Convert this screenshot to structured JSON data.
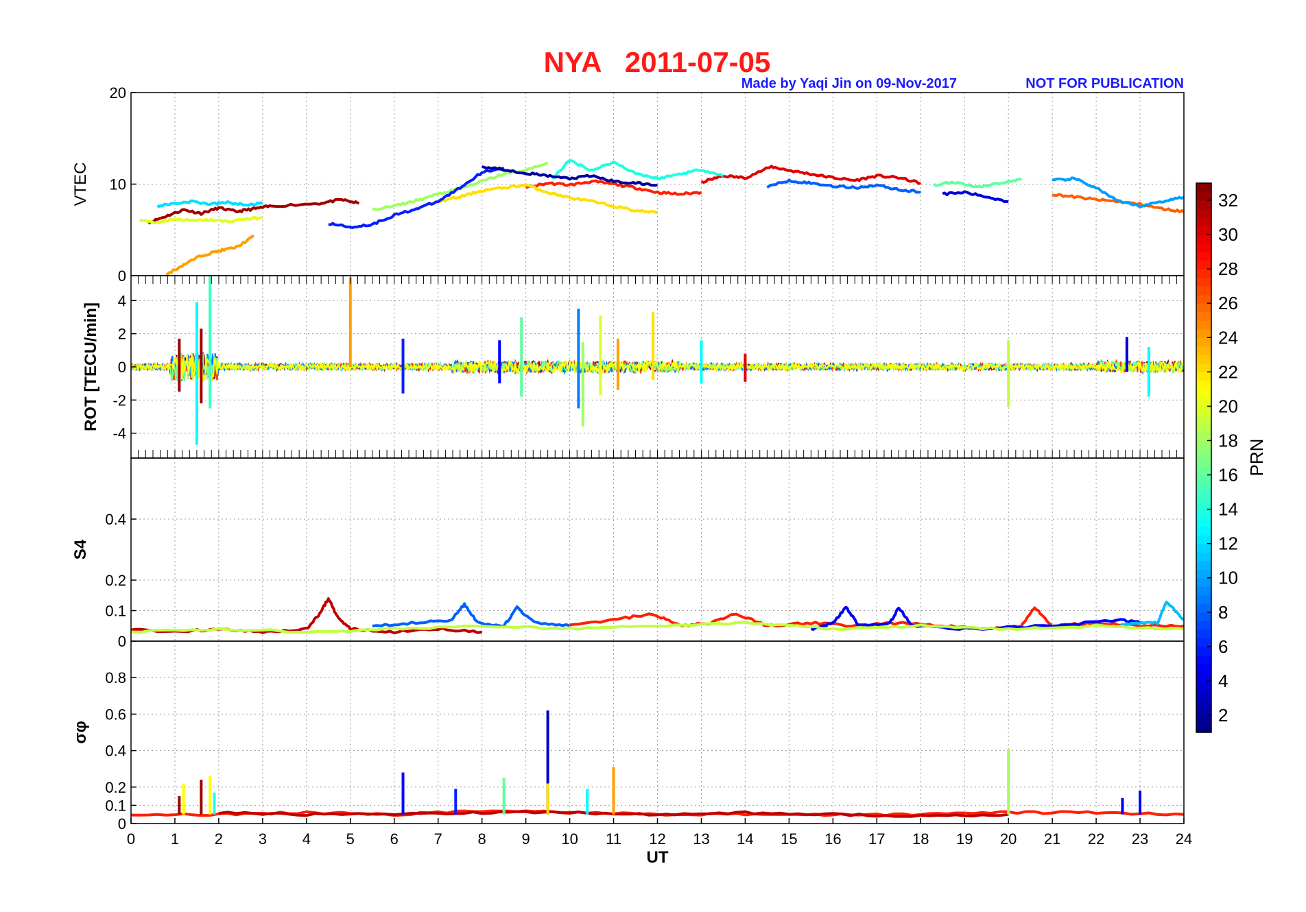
{
  "header": {
    "title": "NYA   2011-07-05",
    "credit": "Made by Yaqi Jin on 09-Nov-2017",
    "notice": "NOT FOR PUBLICATION"
  },
  "chart_data": [
    {
      "type": "line",
      "panel": "vtec",
      "ylabel": "VTEC",
      "xlim": [
        0,
        24
      ],
      "ylim": [
        0,
        20
      ],
      "yticks": [
        0,
        10,
        20
      ],
      "grid": true,
      "series": [
        {
          "prn": 32,
          "x": [
            0.4,
            0.8,
            1.2,
            1.6,
            2.0,
            2.4,
            2.8,
            3.2,
            4.3,
            4.8,
            5.2
          ],
          "y": [
            5.8,
            6.5,
            7.2,
            6.8,
            7.4,
            7.0,
            7.3,
            7.6,
            7.9,
            8.3,
            7.9
          ]
        },
        {
          "prn": 30,
          "x": [
            13.0,
            13.5,
            14.0,
            14.6,
            15.0,
            15.5,
            16.0,
            16.5,
            17.0,
            17.5,
            18.0
          ],
          "y": [
            10.2,
            10.9,
            10.7,
            11.9,
            11.5,
            11.1,
            10.7,
            10.4,
            10.9,
            10.7,
            10.1
          ]
        },
        {
          "prn": 28,
          "x": [
            9.0,
            9.5,
            10.0,
            10.5,
            11.0,
            11.5,
            12.0,
            12.5,
            13.0
          ],
          "y": [
            9.6,
            10.1,
            9.9,
            10.3,
            10.0,
            9.6,
            9.1,
            8.9,
            9.1
          ]
        },
        {
          "prn": 26,
          "x": [
            21.0,
            21.5,
            22.0,
            22.5,
            23.0,
            23.5,
            24.0
          ],
          "y": [
            8.9,
            8.6,
            8.3,
            8.1,
            7.8,
            7.3,
            7.0
          ]
        },
        {
          "prn": 24,
          "x": [
            0.8,
            1.2,
            1.6,
            2.0,
            2.4,
            2.8
          ],
          "y": [
            0.1,
            1.2,
            2.2,
            2.7,
            3.1,
            4.3
          ]
        },
        {
          "prn": 22,
          "x": [
            7.0,
            7.5,
            8.0,
            8.5,
            9.0,
            9.5,
            10.0,
            10.5,
            11.0,
            11.5,
            12.0
          ],
          "y": [
            8.1,
            8.6,
            9.3,
            9.6,
            9.9,
            9.1,
            8.5,
            8.1,
            7.6,
            7.1,
            6.9
          ]
        },
        {
          "prn": 20,
          "x": [
            0.2,
            0.6,
            1.0,
            1.4,
            1.8,
            2.2,
            2.6,
            3.0
          ],
          "y": [
            6.1,
            5.8,
            6.2,
            6.0,
            6.1,
            5.9,
            6.2,
            6.3
          ]
        },
        {
          "prn": 18,
          "x": [
            5.5,
            6.0,
            6.5,
            7.0,
            7.5,
            8.0,
            8.5,
            9.0,
            9.5
          ],
          "y": [
            7.2,
            7.6,
            8.2,
            8.9,
            9.5,
            10.3,
            11.1,
            11.5,
            12.3
          ]
        },
        {
          "prn": 16,
          "x": [
            18.3,
            18.8,
            19.3,
            19.8,
            20.3
          ],
          "y": [
            9.9,
            10.2,
            9.7,
            10.1,
            10.5
          ]
        },
        {
          "prn": 14,
          "x": [
            9.6,
            10.0,
            10.5,
            11.0,
            11.5,
            12.0,
            12.5,
            13.0,
            13.5
          ],
          "y": [
            10.6,
            12.6,
            11.5,
            12.4,
            11.2,
            10.6,
            11.1,
            11.6,
            10.9
          ]
        },
        {
          "prn": 12,
          "x": [
            0.6,
            1.0,
            1.4,
            1.8,
            2.2,
            2.6,
            3.0
          ],
          "y": [
            7.6,
            7.9,
            8.1,
            7.8,
            8.0,
            7.7,
            7.9
          ]
        },
        {
          "prn": 10,
          "x": [
            21.0,
            21.5,
            22.0,
            22.5,
            23.0,
            23.5,
            24.0
          ],
          "y": [
            10.4,
            10.6,
            9.6,
            8.1,
            7.6,
            8.1,
            8.6
          ]
        },
        {
          "prn": 8,
          "x": [
            14.5,
            15.0,
            15.5,
            16.0,
            16.5,
            17.0,
            17.5,
            18.0
          ],
          "y": [
            9.7,
            10.4,
            10.1,
            9.8,
            9.6,
            9.9,
            9.4,
            9.1
          ]
        },
        {
          "prn": 6,
          "x": [
            4.5,
            5.0,
            5.5,
            6.0,
            6.5,
            7.0,
            7.5,
            8.0,
            8.5
          ],
          "y": [
            5.7,
            5.3,
            5.6,
            6.6,
            7.3,
            8.1,
            9.6,
            11.3,
            11.8
          ]
        },
        {
          "prn": 4,
          "x": [
            18.5,
            19.0,
            19.5,
            20.0
          ],
          "y": [
            8.9,
            9.1,
            8.6,
            8.1
          ]
        },
        {
          "prn": 2,
          "x": [
            8.0,
            8.5,
            9.0,
            9.5,
            10.0,
            10.5,
            11.0,
            11.5,
            12.0
          ],
          "y": [
            11.9,
            11.6,
            11.2,
            10.9,
            10.6,
            10.9,
            10.3,
            10.1,
            9.9
          ]
        }
      ]
    },
    {
      "type": "line",
      "panel": "rot",
      "ylabel": "ROT [TECU/min]",
      "xlim": [
        0,
        24
      ],
      "ylim": [
        -5.5,
        5.5
      ],
      "yticks": [
        -4,
        -2,
        0,
        2,
        4
      ],
      "grid": true,
      "spikes": [
        {
          "prn": 13,
          "x": 1.5,
          "min": -4.7,
          "max": 3.9
        },
        {
          "prn": 15,
          "x": 1.8,
          "min": -2.5,
          "max": 5.5
        },
        {
          "prn": 32,
          "x": 1.6,
          "min": -2.2,
          "max": 2.3
        },
        {
          "prn": 32,
          "x": 1.1,
          "min": -1.5,
          "max": 1.7
        },
        {
          "prn": 24,
          "x": 5.0,
          "min": 0.0,
          "max": 5.4
        },
        {
          "prn": 6,
          "x": 6.2,
          "min": -1.6,
          "max": 1.7
        },
        {
          "prn": 5,
          "x": 8.4,
          "min": -1.0,
          "max": 1.6
        },
        {
          "prn": 16,
          "x": 8.9,
          "min": -1.8,
          "max": 3.0
        },
        {
          "prn": 9,
          "x": 10.2,
          "min": -2.5,
          "max": 3.5
        },
        {
          "prn": 18,
          "x": 10.3,
          "min": -3.6,
          "max": 1.5
        },
        {
          "prn": 20,
          "x": 10.7,
          "min": -1.7,
          "max": 3.1
        },
        {
          "prn": 24,
          "x": 11.1,
          "min": -1.4,
          "max": 1.7
        },
        {
          "prn": 22,
          "x": 11.9,
          "min": -0.8,
          "max": 3.3
        },
        {
          "prn": 13,
          "x": 13.0,
          "min": -1.0,
          "max": 1.6
        },
        {
          "prn": 30,
          "x": 14.0,
          "min": -0.9,
          "max": 0.8
        },
        {
          "prn": 19,
          "x": 20.0,
          "min": -2.4,
          "max": 1.6
        },
        {
          "prn": 4,
          "x": 22.7,
          "min": -0.3,
          "max": 1.8
        },
        {
          "prn": 13,
          "x": 23.2,
          "min": -1.8,
          "max": 1.2
        }
      ]
    },
    {
      "type": "line",
      "panel": "s4",
      "ylabel": "S4",
      "xlim": [
        0,
        24
      ],
      "ylim": [
        0,
        0.6
      ],
      "yticks": [
        0,
        0.1,
        0.2,
        0.4
      ],
      "grid": true,
      "series": [
        {
          "prn": 31,
          "x": [
            0.0,
            1.0,
            2.0,
            3.0,
            4.0,
            4.3,
            4.5,
            4.7,
            5.0,
            6.0,
            7.0,
            8.0
          ],
          "y": [
            0.04,
            0.03,
            0.04,
            0.03,
            0.04,
            0.09,
            0.14,
            0.08,
            0.04,
            0.03,
            0.04,
            0.03
          ]
        },
        {
          "prn": 8,
          "x": [
            5.5,
            6.5,
            7.3,
            7.6,
            7.9,
            8.5,
            8.8,
            9.2,
            10.0
          ],
          "y": [
            0.05,
            0.06,
            0.07,
            0.12,
            0.06,
            0.05,
            0.11,
            0.06,
            0.05
          ]
        },
        {
          "prn": 28,
          "x": [
            10.0,
            11.0,
            11.9,
            12.5,
            13.2,
            13.8,
            14.5,
            15.5,
            16.5,
            17.5,
            18.5,
            19.5,
            20.3,
            20.6,
            21.0,
            22.0,
            23.0,
            24.0
          ],
          "y": [
            0.05,
            0.07,
            0.09,
            0.05,
            0.06,
            0.09,
            0.05,
            0.06,
            0.05,
            0.06,
            0.05,
            0.04,
            0.05,
            0.11,
            0.05,
            0.06,
            0.05,
            0.05
          ]
        },
        {
          "prn": 5,
          "x": [
            15.5,
            16.0,
            16.3,
            16.6,
            17.3,
            17.5,
            17.8,
            19.0,
            21.0,
            22.5,
            23.0
          ],
          "y": [
            0.04,
            0.06,
            0.11,
            0.05,
            0.06,
            0.11,
            0.05,
            0.04,
            0.05,
            0.07,
            0.06
          ]
        },
        {
          "prn": 11,
          "x": [
            22.5,
            23.0,
            23.4,
            23.6,
            24.0
          ],
          "y": [
            0.05,
            0.06,
            0.06,
            0.13,
            0.07
          ]
        },
        {
          "prn": 19,
          "x": [
            0.0,
            2.0,
            4.0,
            6.0,
            8.0,
            10.0,
            12.0,
            14.0,
            16.0,
            18.0,
            20.0,
            22.0,
            24.0
          ],
          "y": [
            0.03,
            0.04,
            0.03,
            0.04,
            0.05,
            0.04,
            0.05,
            0.06,
            0.04,
            0.05,
            0.04,
            0.05,
            0.04
          ]
        }
      ]
    },
    {
      "type": "line",
      "panel": "sigma_phi",
      "ylabel": "σφ",
      "xlim": [
        0,
        24
      ],
      "ylim": [
        0,
        1
      ],
      "yticks": [
        0,
        0.1,
        0.2,
        0.4,
        0.6,
        0.8
      ],
      "grid": true,
      "spikes": [
        {
          "prn": 32,
          "x": 1.1,
          "min": 0.05,
          "max": 0.15
        },
        {
          "prn": 32,
          "x": 1.6,
          "min": 0.05,
          "max": 0.24
        },
        {
          "prn": 21,
          "x": 1.2,
          "min": 0.05,
          "max": 0.22
        },
        {
          "prn": 21,
          "x": 1.8,
          "min": 0.05,
          "max": 0.26
        },
        {
          "prn": 14,
          "x": 1.9,
          "min": 0.05,
          "max": 0.17
        },
        {
          "prn": 5,
          "x": 6.2,
          "min": 0.05,
          "max": 0.28
        },
        {
          "prn": 6,
          "x": 7.4,
          "min": 0.05,
          "max": 0.19
        },
        {
          "prn": 16,
          "x": 8.5,
          "min": 0.05,
          "max": 0.25
        },
        {
          "prn": 3,
          "x": 9.5,
          "min": 0.05,
          "max": 0.62
        },
        {
          "prn": 22,
          "x": 9.5,
          "min": 0.05,
          "max": 0.22
        },
        {
          "prn": 13,
          "x": 10.4,
          "min": 0.05,
          "max": 0.19
        },
        {
          "prn": 24,
          "x": 11.0,
          "min": 0.05,
          "max": 0.31
        },
        {
          "prn": 18,
          "x": 20.0,
          "min": 0.05,
          "max": 0.41
        },
        {
          "prn": 5,
          "x": 22.6,
          "min": 0.05,
          "max": 0.14
        },
        {
          "prn": 5,
          "x": 23.0,
          "min": 0.05,
          "max": 0.18
        }
      ],
      "series": [
        {
          "prn": 28,
          "x": [
            0.0,
            2.0,
            4.0,
            6.0,
            8.0,
            10.0,
            12.0,
            14.0,
            16.0,
            18.0,
            20.0,
            22.0,
            24.0
          ],
          "y": [
            0.05,
            0.05,
            0.06,
            0.05,
            0.07,
            0.06,
            0.05,
            0.05,
            0.05,
            0.05,
            0.06,
            0.06,
            0.05
          ]
        },
        {
          "prn": 31,
          "x": [
            2.0,
            4.0,
            6.0,
            8.0,
            10.0,
            12.0,
            14.0,
            16.0,
            18.0,
            20.0
          ],
          "y": [
            0.06,
            0.05,
            0.05,
            0.06,
            0.06,
            0.05,
            0.06,
            0.05,
            0.04,
            0.05
          ]
        }
      ]
    }
  ],
  "xaxis": {
    "label": "UT",
    "ticks": [
      0,
      1,
      2,
      3,
      4,
      5,
      6,
      7,
      8,
      9,
      10,
      11,
      12,
      13,
      14,
      15,
      16,
      17,
      18,
      19,
      20,
      21,
      22,
      23,
      24
    ]
  },
  "colorbar": {
    "label": "PRN",
    "range": [
      1,
      33
    ],
    "ticks": [
      2,
      4,
      6,
      8,
      10,
      12,
      14,
      16,
      18,
      20,
      22,
      24,
      26,
      28,
      30,
      32
    ],
    "colormap": "jet"
  }
}
